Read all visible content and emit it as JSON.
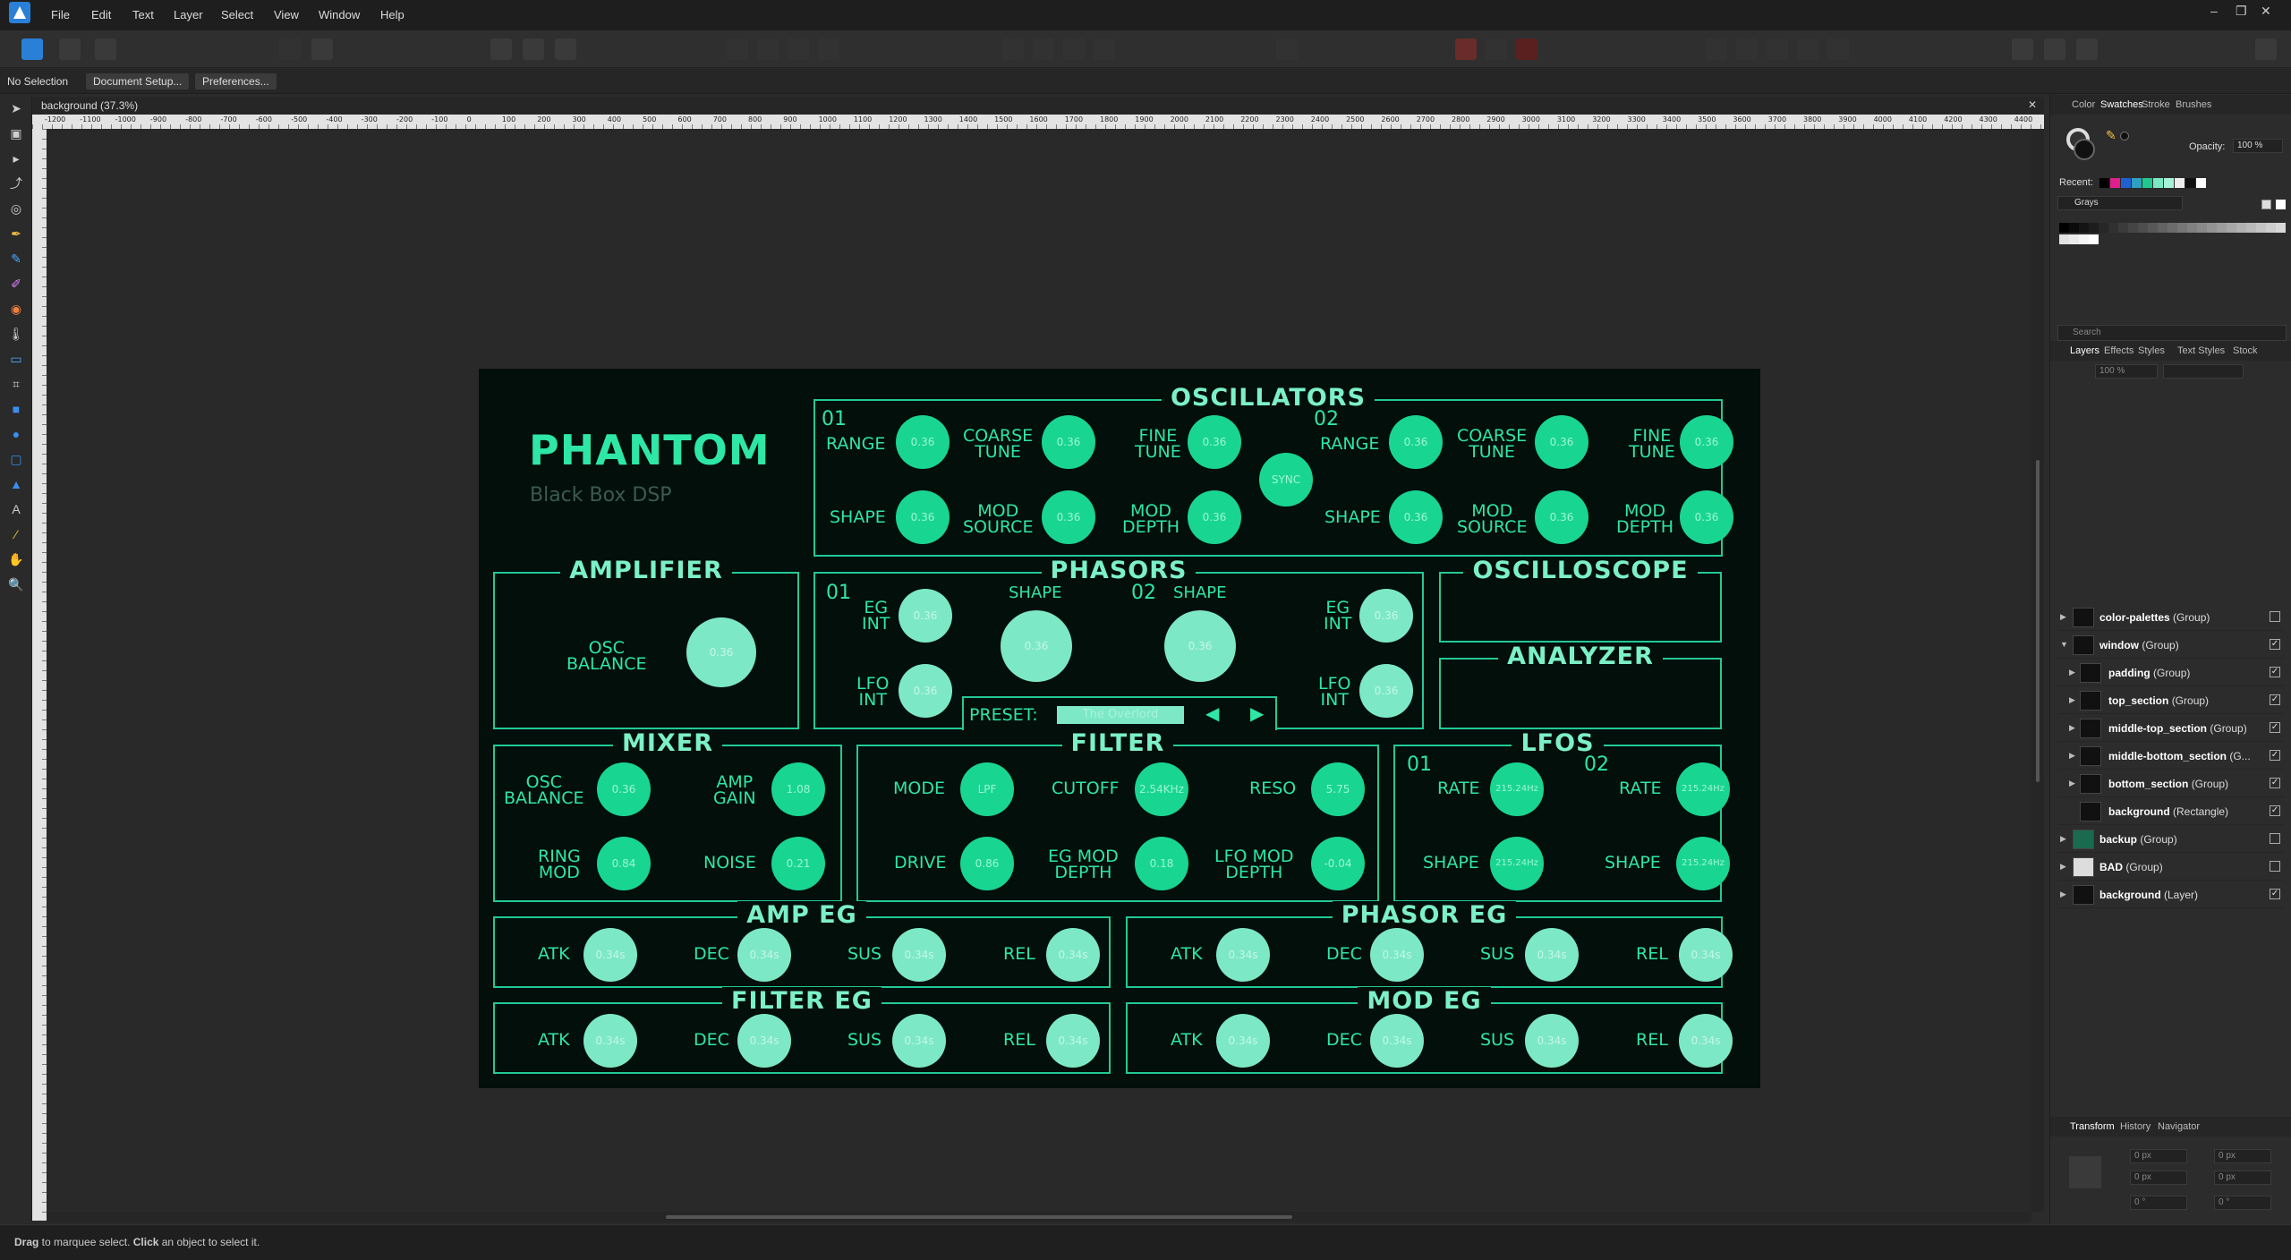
{
  "menubar": {
    "items": [
      "File",
      "Edit",
      "Text",
      "Layer",
      "Select",
      "View",
      "Window",
      "Help"
    ],
    "window_controls": [
      "–",
      "❐",
      "✕"
    ]
  },
  "context": {
    "selection": "No Selection",
    "document_setup": "Document Setup...",
    "preferences": "Preferences..."
  },
  "document": {
    "tab_title": "background (37.3%)"
  },
  "ruler": {
    "h_labels": [
      "-1200",
      "-1100",
      "-1000",
      "-900",
      "-800",
      "-700",
      "-600",
      "-500",
      "-400",
      "-300",
      "-200",
      "-100",
      "0",
      "100",
      "200",
      "300",
      "400",
      "500",
      "600",
      "700",
      "800",
      "900",
      "1000",
      "1100",
      "1200",
      "1300",
      "1400",
      "1500",
      "1600",
      "1700",
      "1800",
      "1900",
      "2000",
      "2100",
      "2200",
      "2300",
      "2400",
      "2500",
      "2600",
      "2700",
      "2800",
      "2900",
      "3000",
      "3100",
      "3200",
      "3300",
      "3400",
      "3500",
      "3600",
      "3700",
      "3800",
      "3900",
      "4000",
      "4100",
      "4200",
      "4300",
      "4400"
    ]
  },
  "status": {
    "drag": "Drag",
    "drag_rest": " to marquee select. ",
    "click": "Click",
    "click_rest": " an object to select it."
  },
  "right_panel": {
    "color_tabs": [
      "Color",
      "Swatches",
      "Stroke",
      "Brushes"
    ],
    "opacity_label": "Opacity:",
    "opacity_value": "100 %",
    "recent_label": "Recent:",
    "palette_name": "Grays",
    "search_placeholder": "Search",
    "layer_tabs": [
      "Layers",
      "Effects",
      "Styles",
      "Text Styles",
      "Stock"
    ],
    "layer_opacity": "100 %",
    "layers": [
      {
        "name": "color-palettes",
        "kind": "(Group)",
        "checked": false
      },
      {
        "name": "window",
        "kind": "(Group)",
        "checked": true
      },
      {
        "name": "padding",
        "kind": "(Group)",
        "checked": true
      },
      {
        "name": "top_section",
        "kind": "(Group)",
        "checked": true
      },
      {
        "name": "middle-top_section",
        "kind": "(Group)",
        "checked": true
      },
      {
        "name": "middle-bottom_section",
        "kind": "(G...",
        "checked": true
      },
      {
        "name": "bottom_section",
        "kind": "(Group)",
        "checked": true
      },
      {
        "name": "background",
        "kind": "(Rectangle)",
        "checked": true
      },
      {
        "name": "backup",
        "kind": "(Group)",
        "checked": false
      },
      {
        "name": "BAD",
        "kind": "(Group)",
        "checked": false
      },
      {
        "name": "background",
        "kind": "(Layer)",
        "checked": true
      }
    ],
    "transform_tabs": [
      "Transform",
      "History",
      "Navigator"
    ],
    "transform_fields": [
      "0 px",
      "0 px",
      "0 px",
      "0 px",
      "0 °",
      "0 °"
    ]
  },
  "synth": {
    "title": "PHANTOM",
    "subtitle": "Black Box DSP",
    "oscillators": {
      "title": "OSCILLATORS",
      "osc1_num": "01",
      "osc2_num": "02",
      "range": "RANGE",
      "coarse_l1": "COARSE",
      "coarse_l2": "TUNE",
      "fine_l1": "FINE",
      "fine_l2": "TUNE",
      "shape": "SHAPE",
      "modsrc_l1": "MOD",
      "modsrc_l2": "SOURCE",
      "moddep_l1": "MOD",
      "moddep_l2": "DEPTH",
      "sync": "SYNC",
      "value": "0.36"
    },
    "amplifier": {
      "title": "AMPLIFIER",
      "osc_l1": "OSC",
      "osc_l2": "BALANCE",
      "value": "0.36"
    },
    "phasors": {
      "title": "PHASORS",
      "n1": "01",
      "n2": "02",
      "shape": "SHAPE",
      "eg_l1": "EG",
      "eg_l2": "INT",
      "lfo_l1": "LFO",
      "lfo_l2": "INT",
      "value": "0.36",
      "preset_label": "PRESET:",
      "preset_value": "The Overlord",
      "prev": "◀",
      "next": "▶"
    },
    "oscilloscope": {
      "title": "OSCILLOSCOPE"
    },
    "analyzer": {
      "title": "ANALYZER"
    },
    "mixer": {
      "title": "MIXER",
      "osc_l1": "OSC",
      "osc_l2": "BALANCE",
      "osc_val": "0.36",
      "amp_l1": "AMP",
      "amp_l2": "GAIN",
      "amp_val": "1.08",
      "ring_l1": "RING",
      "ring_l2": "MOD",
      "ring_val": "0.84",
      "noise": "NOISE",
      "noise_val": "0.21"
    },
    "filter": {
      "title": "FILTER",
      "mode": "MODE",
      "mode_val": "LPF",
      "cutoff": "CUTOFF",
      "cutoff_val": "2.54KHz",
      "reso": "RESO",
      "reso_val": "5.75",
      "drive": "DRIVE",
      "drive_val": "0.86",
      "egmod_l1": "EG MOD",
      "egmod_l2": "DEPTH",
      "egmod_val": "0.18",
      "lfomod_l1": "LFO MOD",
      "lfomod_l2": "DEPTH",
      "lfomod_val": "-0.04"
    },
    "lfos": {
      "title": "LFOS",
      "n1": "01",
      "n2": "02",
      "rate": "RATE",
      "shape": "SHAPE",
      "value": "215.24Hz"
    },
    "amp_eg": {
      "title": "AMP EG"
    },
    "phasor_eg": {
      "title": "PHASOR EG"
    },
    "filter_eg": {
      "title": "FILTER EG"
    },
    "mod_eg": {
      "title": "MOD EG"
    },
    "eg_labels": {
      "atk": "ATK",
      "dec": "DEC",
      "sus": "SUS",
      "rel": "REL",
      "value": "0.34s"
    }
  }
}
